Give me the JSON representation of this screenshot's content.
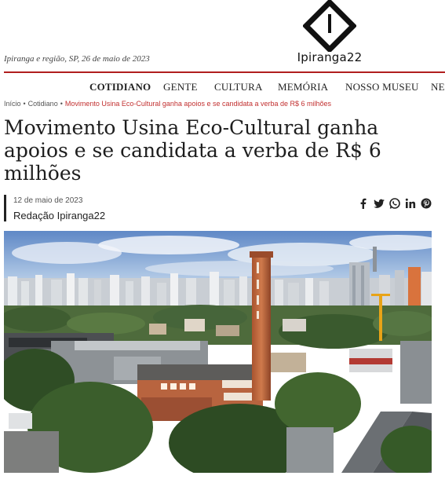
{
  "header": {
    "dateline": "Ipiranga e região, SP, 26 de maio de 2023",
    "logo_text": "Ipiranga22"
  },
  "nav": {
    "items": [
      {
        "label": "COTIDIANO",
        "active": true
      },
      {
        "label": "GENTE",
        "active": false
      },
      {
        "label": "CULTURA",
        "active": false
      },
      {
        "label": "MEMÓRIA",
        "active": false
      },
      {
        "label": "NOSSO MUSEU",
        "active": false
      },
      {
        "label": "NE",
        "active": false
      }
    ]
  },
  "breadcrumb": {
    "home": "Início",
    "section": "Cotidiano",
    "current": "Movimento Usina Eco-Cultural ganha apoios e se candidata a verba de R$ 6 milhões",
    "separator": "•"
  },
  "article": {
    "title": "Movimento Usina Eco-Cultural ganha apoios e se candidata a verba de R$ 6 milhões",
    "date": "12 de maio de 2023",
    "author": "Redação Ipiranga22"
  },
  "share": {
    "icons": [
      "facebook-icon",
      "twitter-icon",
      "whatsapp-icon",
      "linkedin-icon",
      "pinterest-icon"
    ]
  },
  "colors": {
    "accent_red": "#b01e1e",
    "breadcrumb_current": "#c23030"
  }
}
